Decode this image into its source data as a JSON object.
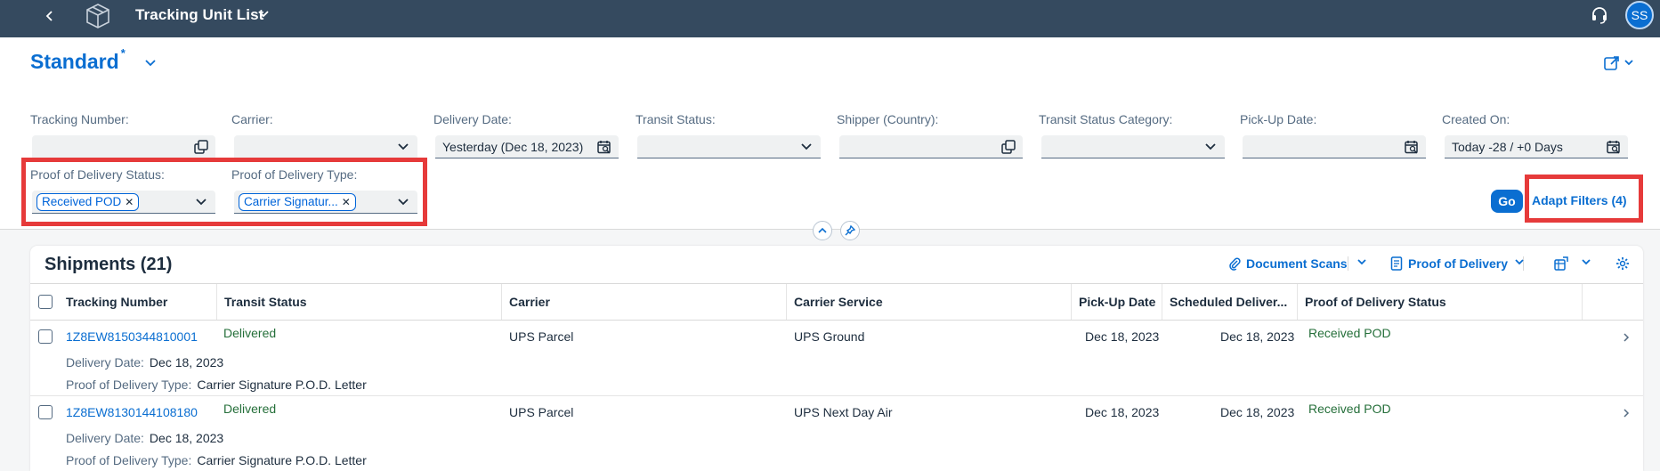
{
  "shell": {
    "title": "Tracking Unit List",
    "user_initials": "SS"
  },
  "header": {
    "variant_name": "Standard",
    "variant_modified": "*",
    "filters": {
      "tracking_number": {
        "label": "Tracking Number:",
        "value": ""
      },
      "carrier": {
        "label": "Carrier:",
        "value": ""
      },
      "delivery_date": {
        "label": "Delivery Date:",
        "value": "Yesterday (Dec 18, 2023)"
      },
      "transit_status": {
        "label": "Transit Status:",
        "value": ""
      },
      "shipper_country": {
        "label": "Shipper (Country):",
        "value": ""
      },
      "transit_status_category": {
        "label": "Transit Status Category:",
        "value": ""
      },
      "pickup_date": {
        "label": "Pick-Up Date:",
        "value": ""
      },
      "created_on": {
        "label": "Created On:",
        "value": "Today -28 / +0 Days"
      },
      "pod_status": {
        "label": "Proof of Delivery Status:",
        "token": "Received POD"
      },
      "pod_type": {
        "label": "Proof of Delivery Type:",
        "token": "Carrier Signatur..."
      }
    },
    "go_label": "Go",
    "adapt_filters_label": "Adapt Filters (4)"
  },
  "table": {
    "title": "Shipments (21)",
    "toolbar": {
      "document_scans": "Document Scans",
      "proof_of_delivery": "Proof of Delivery"
    },
    "columns": [
      "Tracking Number",
      "Transit Status",
      "Carrier",
      "Carrier Service",
      "Pick-Up Date",
      "Scheduled Deliver...",
      "Proof of Delivery Status"
    ],
    "sub_labels": {
      "delivery_date": "Delivery Date:",
      "pod_type": "Proof of Delivery Type:"
    },
    "rows": [
      {
        "tracking_number": "1Z8EW8150344810001",
        "transit_status": "Delivered",
        "carrier": "UPS Parcel",
        "carrier_service": "UPS Ground",
        "pickup_date": "Dec 18, 2023",
        "scheduled_delivery": "Dec 18, 2023",
        "pod_status": "Received POD",
        "delivery_date": "Dec 18, 2023",
        "pod_type": "Carrier Signature P.O.D. Letter"
      },
      {
        "tracking_number": "1Z8EW8130144108180",
        "transit_status": "Delivered",
        "carrier": "UPS Parcel",
        "carrier_service": "UPS Next Day Air",
        "pickup_date": "Dec 18, 2023",
        "scheduled_delivery": "Dec 18, 2023",
        "pod_status": "Received POD",
        "delivery_date": "Dec 18, 2023",
        "pod_type": "Carrier Signature P.O.D. Letter"
      }
    ]
  },
  "colors": {
    "shell_bg": "#354a5f",
    "accent": "#0a6ed1",
    "positive": "#256f3a",
    "highlight": "#e63a3a"
  }
}
